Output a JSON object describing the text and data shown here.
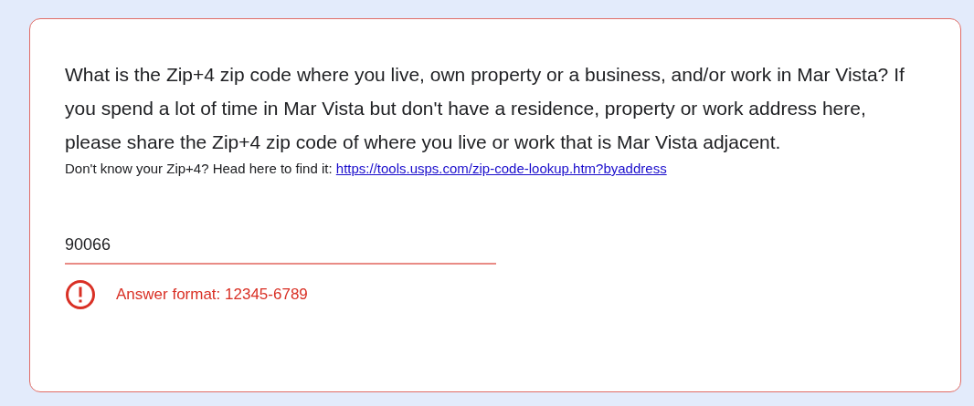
{
  "question": {
    "title": "What is the Zip+4 zip code where you live, own property or a business, and/or work in Mar Vista? If you spend a lot of time in Mar Vista but don't have a residence, property or work address here, please share the Zip+4 zip code of where you live or work that is Mar Vista adjacent.",
    "help_text": "Don't know your Zip+4? Head here to find it:",
    "help_link": "https://tools.usps.com/zip-code-lookup.htm?byaddress",
    "answer": "90066",
    "invalid": true,
    "error": "Answer format: 12345-6789"
  }
}
